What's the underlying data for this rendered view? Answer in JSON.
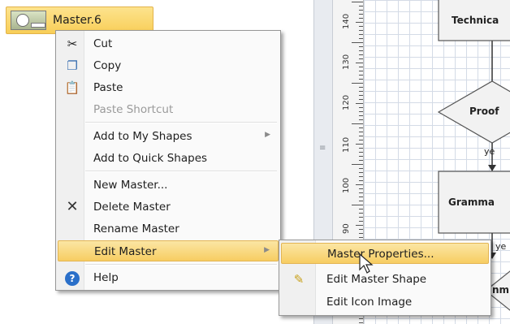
{
  "master": {
    "label": "Master.6"
  },
  "context_menu": {
    "items": [
      {
        "label": "Cut",
        "icon": "scissors-icon",
        "disabled": false
      },
      {
        "label": "Copy",
        "icon": "copy-icon",
        "disabled": false
      },
      {
        "label": "Paste",
        "icon": "paste-icon",
        "disabled": false
      },
      {
        "label": "Paste Shortcut",
        "disabled": true
      },
      {
        "label": "Add to My Shapes",
        "submenu": true
      },
      {
        "label": "Add to Quick Shapes"
      },
      {
        "label": "New Master..."
      },
      {
        "label": "Delete Master",
        "icon": "delete-x-icon"
      },
      {
        "label": "Rename Master"
      },
      {
        "label": "Edit Master",
        "submenu": true,
        "highlighted": true
      },
      {
        "label": "Help",
        "icon": "help-icon"
      }
    ]
  },
  "edit_master_submenu": {
    "items": [
      {
        "label": "Master Properties...",
        "highlighted": true
      },
      {
        "label": "Edit Master Shape",
        "icon": "edit-shape-icon"
      },
      {
        "label": "Edit Icon Image"
      }
    ]
  },
  "ruler": {
    "labels": [
      "140",
      "130",
      "120",
      "110",
      "100",
      "90"
    ]
  },
  "diagram": {
    "shapes": [
      "Technica",
      "Proof",
      "Gramma",
      "nm"
    ],
    "connector_labels": [
      "ye",
      "ye"
    ]
  },
  "colors": {
    "highlight": "#f7cd62",
    "menu_bg": "#fafafa",
    "help_blue": "#2a6fc9"
  }
}
